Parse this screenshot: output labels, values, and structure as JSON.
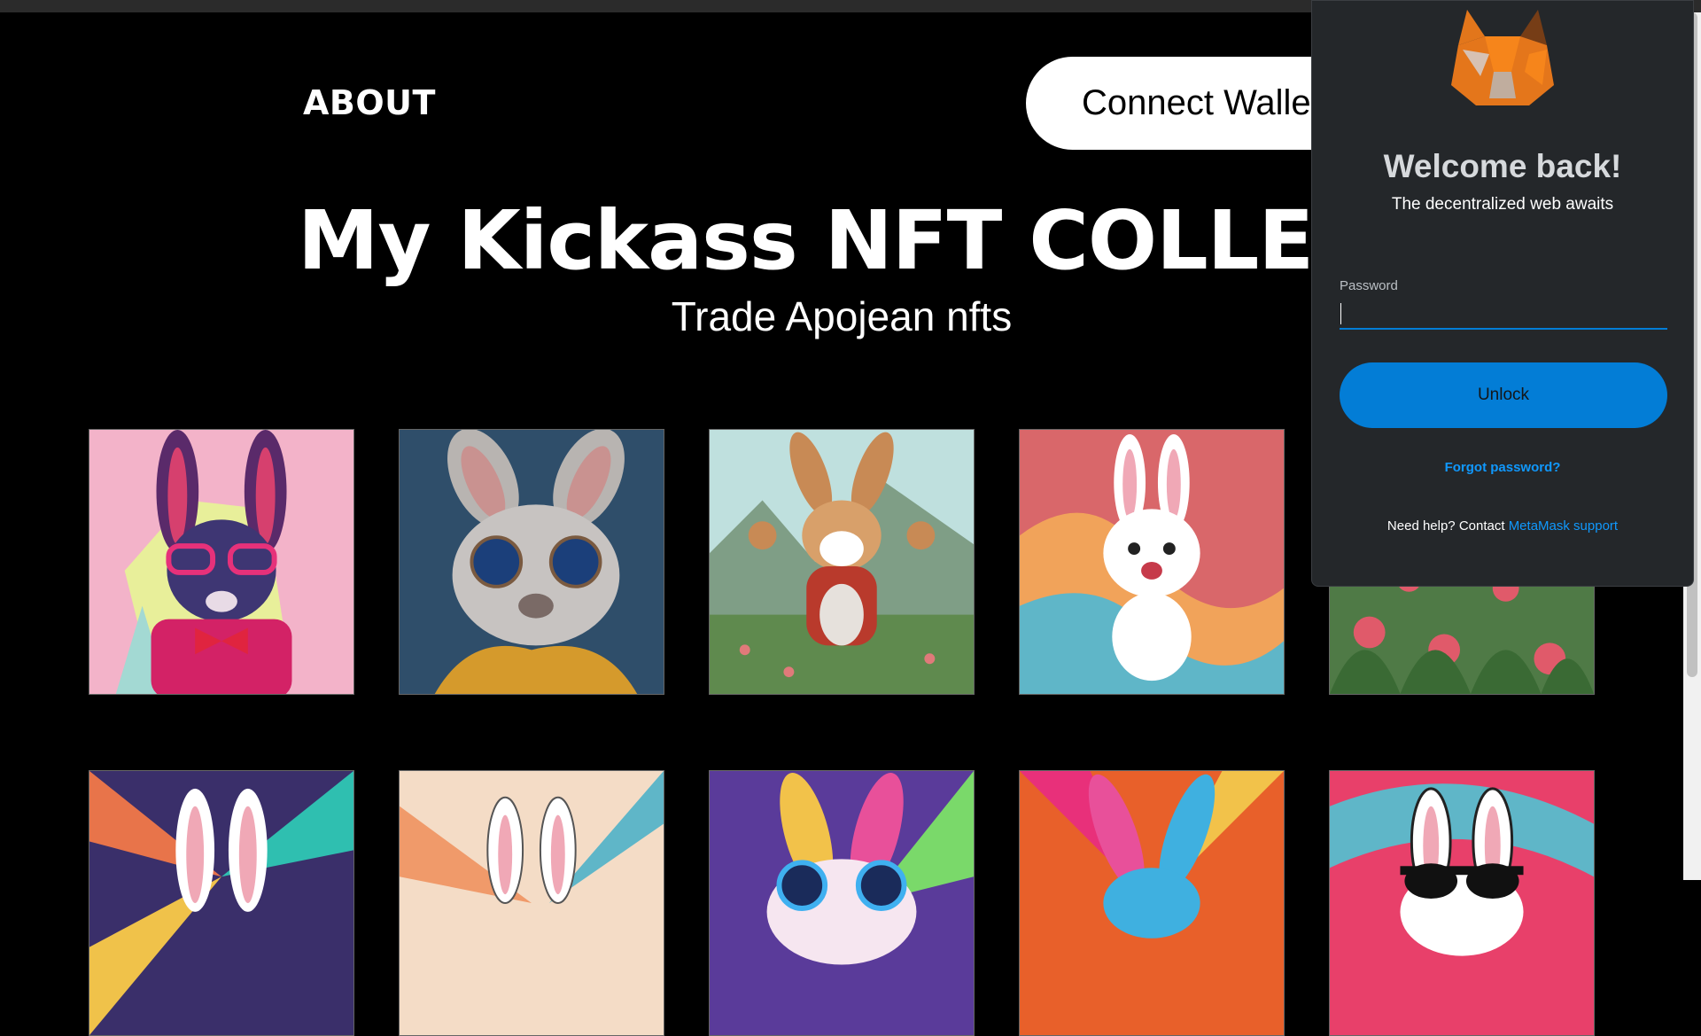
{
  "nav": {
    "about_label": "ABOUT",
    "connect_label": "Connect Wallet"
  },
  "hero": {
    "title": "My Kickass NFT COLLECTION",
    "subtitle": "Trade Apojean nfts"
  },
  "nft_grid": {
    "row1": [
      "pink-bunny-sunglasses",
      "grey-bunny-jacket",
      "cartoon-bunny-field",
      "white-bunny-swirls",
      "bunny-in-flowers"
    ],
    "row2": [
      "bunny-rays",
      "bunny-splash",
      "rainbow-bunny",
      "blue-bunny-burst",
      "bunny-black-shades"
    ]
  },
  "metamask": {
    "title": "Welcome back!",
    "subtitle": "The decentralized web awaits",
    "password_label": "Password",
    "password_value": "",
    "unlock_label": "Unlock",
    "forgot_label": "Forgot password?",
    "help_prefix": "Need help? Contact ",
    "help_link": "MetaMask support"
  },
  "colors": {
    "accent": "#037dd6",
    "link": "#1098fc",
    "popup_bg": "#24272a"
  }
}
